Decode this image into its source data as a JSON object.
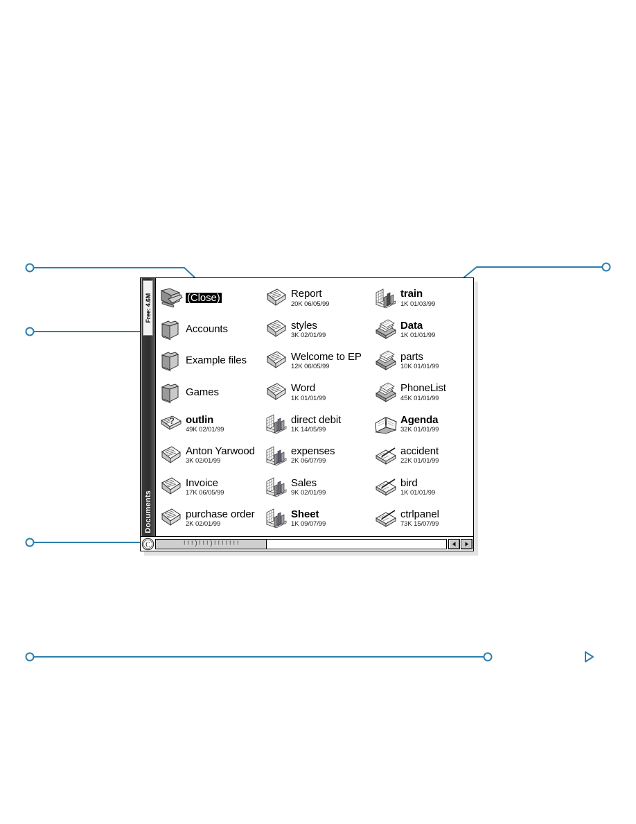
{
  "window": {
    "sidebar": {
      "free_label": "Free: 4.6M",
      "title": "Documents"
    },
    "footer": {
      "c_button_label": "C",
      "scroll_thumb_texture": "!!!)!!!)!!!!!!!",
      "scroll_left_label": "◄",
      "scroll_right_label": "►"
    },
    "columns": [
      {
        "name": "column-1",
        "items": [
          {
            "label": "(Close)",
            "meta": "",
            "icon": "folder-open-icon",
            "selected": true,
            "bold": false
          },
          {
            "label": "Accounts",
            "meta": "",
            "icon": "folder-icon",
            "selected": false,
            "bold": false
          },
          {
            "label": "Example files",
            "meta": "",
            "icon": "folder-icon",
            "selected": false,
            "bold": false
          },
          {
            "label": "Games",
            "meta": "",
            "icon": "folder-icon",
            "selected": false,
            "bold": false
          },
          {
            "label": "outlin",
            "meta": "49K 02/01/99",
            "icon": "unknown-document-icon",
            "selected": false,
            "bold": true
          },
          {
            "label": "Anton Yarwood",
            "meta": "3K 02/01/99",
            "icon": "document-icon",
            "selected": false,
            "bold": false
          },
          {
            "label": "Invoice",
            "meta": "17K 06/05/99",
            "icon": "document-icon",
            "selected": false,
            "bold": false
          },
          {
            "label": "purchase order",
            "meta": "2K 02/01/99",
            "icon": "document-icon",
            "selected": false,
            "bold": false
          }
        ]
      },
      {
        "name": "column-2",
        "items": [
          {
            "label": "Report",
            "meta": "20K 06/05/99",
            "icon": "document-icon",
            "selected": false,
            "bold": false
          },
          {
            "label": "styles",
            "meta": "3K 02/01/99",
            "icon": "document-icon",
            "selected": false,
            "bold": false
          },
          {
            "label": "Welcome to EP",
            "meta": "12K 06/05/99",
            "icon": "document-icon",
            "selected": false,
            "bold": false
          },
          {
            "label": "Word",
            "meta": "1K 01/01/99",
            "icon": "document-icon",
            "selected": false,
            "bold": false
          },
          {
            "label": "direct debit",
            "meta": "1K 14/05/99",
            "icon": "spreadsheet-icon",
            "selected": false,
            "bold": false
          },
          {
            "label": "expenses",
            "meta": "2K 06/07/99",
            "icon": "spreadsheet-icon",
            "selected": false,
            "bold": false
          },
          {
            "label": "Sales",
            "meta": "9K 02/01/99",
            "icon": "spreadsheet-icon",
            "selected": false,
            "bold": false
          },
          {
            "label": "Sheet",
            "meta": "1K 09/07/99",
            "icon": "spreadsheet-icon",
            "selected": false,
            "bold": true
          }
        ]
      },
      {
        "name": "column-3",
        "items": [
          {
            "label": "train",
            "meta": "1K 01/03/99",
            "icon": "spreadsheet-icon",
            "selected": false,
            "bold": true
          },
          {
            "label": "Data",
            "meta": "1K 01/01/99",
            "icon": "database-icon",
            "selected": false,
            "bold": true
          },
          {
            "label": "parts",
            "meta": "10K 01/01/99",
            "icon": "database-icon",
            "selected": false,
            "bold": false
          },
          {
            "label": "PhoneList",
            "meta": "45K 01/01/99",
            "icon": "database-icon",
            "selected": false,
            "bold": false
          },
          {
            "label": "Agenda",
            "meta": "32K 01/01/99",
            "icon": "agenda-icon",
            "selected": false,
            "bold": true
          },
          {
            "label": "accident",
            "meta": "22K 01/01/99",
            "icon": "sketch-icon",
            "selected": false,
            "bold": false
          },
          {
            "label": "bird",
            "meta": "1K 01/01/99",
            "icon": "sketch-icon",
            "selected": false,
            "bold": false
          },
          {
            "label": "ctrlpanel",
            "meta": "73K 15/07/99",
            "icon": "sketch-icon",
            "selected": false,
            "bold": false
          }
        ]
      }
    ]
  },
  "annotations": {
    "accent_color": "#2b7fad",
    "callouts": [
      {
        "name": "callout-close-item"
      },
      {
        "name": "callout-free-memory"
      },
      {
        "name": "callout-c-button"
      },
      {
        "name": "callout-file-area"
      },
      {
        "name": "callout-bottom-rule"
      }
    ]
  }
}
